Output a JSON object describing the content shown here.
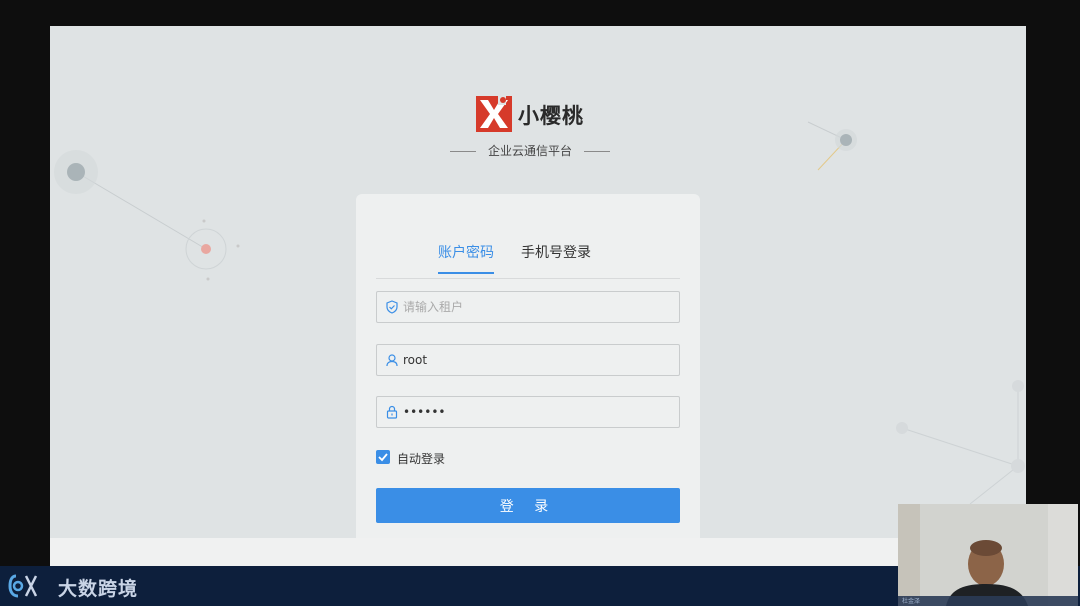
{
  "brand": {
    "name": "小樱桃",
    "subtitle": "企业云通信平台"
  },
  "login": {
    "tabs": [
      {
        "label": "账户密码",
        "active": true
      },
      {
        "label": "手机号登录",
        "active": false
      }
    ],
    "tenant": {
      "placeholder": "请输入租户",
      "value": ""
    },
    "username": {
      "value": "root"
    },
    "password": {
      "value": "••••••"
    },
    "remember": {
      "label": "自动登录",
      "checked": true
    },
    "submit_label": "登 录"
  },
  "banner": {
    "text": "大数跨境"
  },
  "webcam": {
    "name": "杜金泽"
  },
  "colors": {
    "accent": "#3a8ee6",
    "logo_red": "#d63a2a",
    "background": "#dfe3e4",
    "banner": "#0d1f3c"
  },
  "icons": [
    "shield-icon",
    "user-icon",
    "lock-icon",
    "check-icon"
  ]
}
